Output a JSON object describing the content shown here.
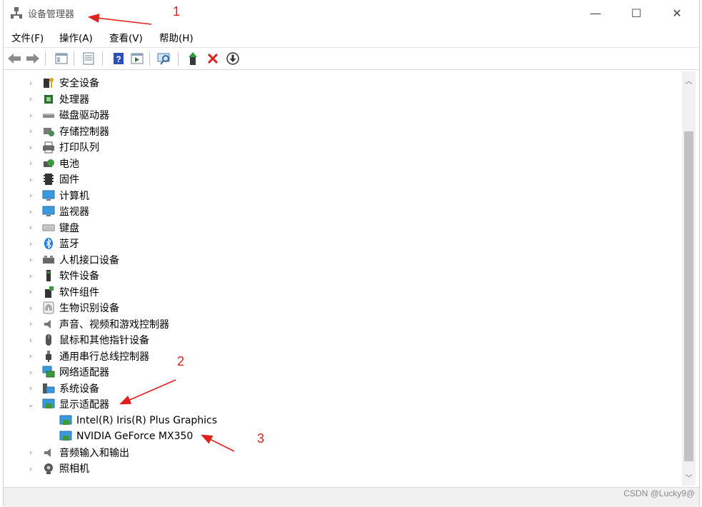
{
  "window": {
    "title": "设备管理器"
  },
  "window_controls": {
    "minimize": "—",
    "maximize": "☐",
    "close": "✕"
  },
  "menu": [
    "文件(F)",
    "操作(A)",
    "查看(V)",
    "帮助(H)"
  ],
  "toolbar_icons": [
    "back-icon",
    "forward-icon",
    "show-hide-tree-icon",
    "properties-icon",
    "help-icon",
    "action-pane-icon",
    "scan-hardware-icon",
    "update-driver-icon",
    "uninstall-device-icon",
    "disable-device-icon"
  ],
  "tree": {
    "categories": [
      {
        "label": "安全设备",
        "icon": "security-device-icon",
        "expanded": false
      },
      {
        "label": "处理器",
        "icon": "processor-icon",
        "expanded": false
      },
      {
        "label": "磁盘驱动器",
        "icon": "disk-drive-icon",
        "expanded": false
      },
      {
        "label": "存储控制器",
        "icon": "storage-controller-icon",
        "expanded": false
      },
      {
        "label": "打印队列",
        "icon": "printer-icon",
        "expanded": false
      },
      {
        "label": "电池",
        "icon": "battery-icon",
        "expanded": false
      },
      {
        "label": "固件",
        "icon": "firmware-icon",
        "expanded": false
      },
      {
        "label": "计算机",
        "icon": "computer-icon",
        "expanded": false
      },
      {
        "label": "监视器",
        "icon": "monitor-icon",
        "expanded": false
      },
      {
        "label": "键盘",
        "icon": "keyboard-icon",
        "expanded": false
      },
      {
        "label": "蓝牙",
        "icon": "bluetooth-icon",
        "expanded": false
      },
      {
        "label": "人机接口设备",
        "icon": "hid-icon",
        "expanded": false
      },
      {
        "label": "软件设备",
        "icon": "software-device-icon",
        "expanded": false
      },
      {
        "label": "软件组件",
        "icon": "software-component-icon",
        "expanded": false
      },
      {
        "label": "生物识别设备",
        "icon": "biometric-icon",
        "expanded": false
      },
      {
        "label": "声音、视频和游戏控制器",
        "icon": "sound-icon",
        "expanded": false
      },
      {
        "label": "鼠标和其他指针设备",
        "icon": "mouse-icon",
        "expanded": false
      },
      {
        "label": "通用串行总线控制器",
        "icon": "usb-icon",
        "expanded": false
      },
      {
        "label": "网络适配器",
        "icon": "network-adapter-icon",
        "expanded": false
      },
      {
        "label": "系统设备",
        "icon": "system-device-icon",
        "expanded": false
      },
      {
        "label": "显示适配器",
        "icon": "display-adapter-icon",
        "expanded": true,
        "children": [
          {
            "label": "Intel(R) Iris(R) Plus Graphics",
            "icon": "display-adapter-icon"
          },
          {
            "label": "NVIDIA GeForce MX350",
            "icon": "display-adapter-icon"
          }
        ]
      },
      {
        "label": "音频输入和输出",
        "icon": "audio-io-icon",
        "expanded": false
      },
      {
        "label": "照相机",
        "icon": "camera-icon",
        "expanded": false
      }
    ]
  },
  "annotations": [
    "1",
    "2",
    "3"
  ],
  "watermark": "CSDN @Lucky9@",
  "colors": {
    "annotation_red": "#e0201c",
    "accent_blue": "#1e7bd6"
  }
}
